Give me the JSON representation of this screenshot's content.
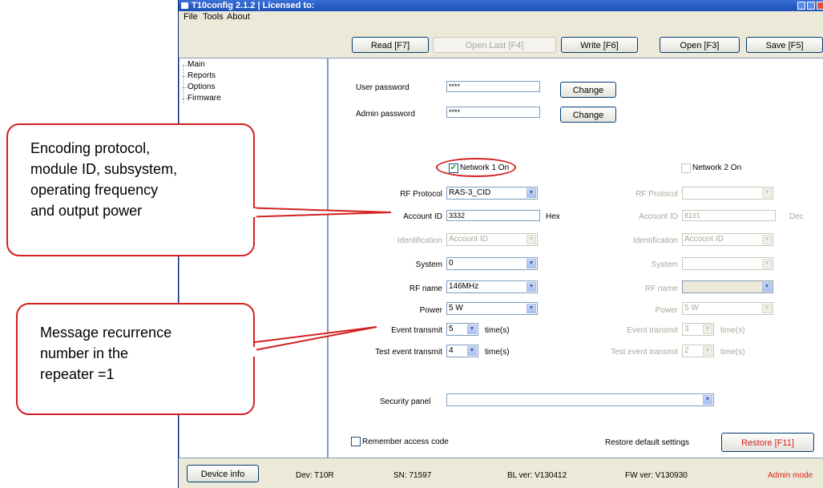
{
  "window": {
    "title": "T10config 2.1.2  |  Licensed to:",
    "menu": [
      "File",
      "Tools",
      "About"
    ]
  },
  "toolbar": {
    "read": "Read [F7]",
    "open_last": "Open Last [F4]",
    "write": "Write [F6]",
    "open": "Open [F3]",
    "save": "Save [F5]"
  },
  "sidebar": {
    "items": [
      "Main",
      "Reports",
      "Options",
      "Firmware"
    ]
  },
  "passwords": {
    "user_label": "User password",
    "user_value": "****",
    "admin_label": "Admin password",
    "admin_value": "****",
    "change": "Change"
  },
  "network1": {
    "enabled_label": "Network 1 On",
    "checked": true,
    "rf_protocol_label": "RF Protocol",
    "rf_protocol": "RAS-3_CID",
    "account_id_label": "Account ID",
    "account_id": "3332",
    "account_unit": "Hex",
    "identification_label": "Identification",
    "identification": "Account ID",
    "system_label": "System",
    "system": "0",
    "rf_name_label": "RF name",
    "rf_name": "146MHz",
    "power_label": "Power",
    "power": "5 W",
    "event_transmit_label": "Event transmit",
    "event_transmit": "5",
    "test_event_transmit_label": "Test event transmit",
    "test_event_transmit": "4",
    "times_unit": "time(s)"
  },
  "network2": {
    "enabled_label": "Network 2 On",
    "checked": false,
    "rf_protocol_label": "RF Protocol",
    "rf_protocol": "",
    "account_id_label": "Account ID",
    "account_id": "8191",
    "account_unit": "Dec",
    "identification_label": "Identification",
    "identification": "Account ID",
    "system_label": "System",
    "system": "",
    "rf_name_label": "RF name",
    "rf_name": "",
    "power_label": "Power",
    "power": "5 W",
    "event_transmit_label": "Event transmit",
    "event_transmit": "3",
    "test_event_transmit_label": "Test event transmit",
    "test_event_transmit": "2",
    "times_unit": "time(s)"
  },
  "security": {
    "label": "Security panel",
    "value": ""
  },
  "footer": {
    "remember_label": "Remember access code",
    "restore_label": "Restore default settings",
    "restore_button": "Restore [F11]"
  },
  "status": {
    "device_info": "Device info",
    "dev": "Dev:  T10R",
    "sn": "SN:  71597",
    "bl": "BL ver:  V130412",
    "fw": "FW ver:  V130930",
    "mode": "Admin mode",
    "mode_color": "#e02020"
  },
  "callouts": {
    "top": [
      "Encoding protocol,",
      "module ID, subsystem,",
      "operating frequency",
      "and output power"
    ],
    "bottom": [
      "Message recurrence",
      "number in the",
      "repeater =1"
    ]
  },
  "colors": {
    "accent_red": "#d42020",
    "check_green": "#21a121"
  }
}
